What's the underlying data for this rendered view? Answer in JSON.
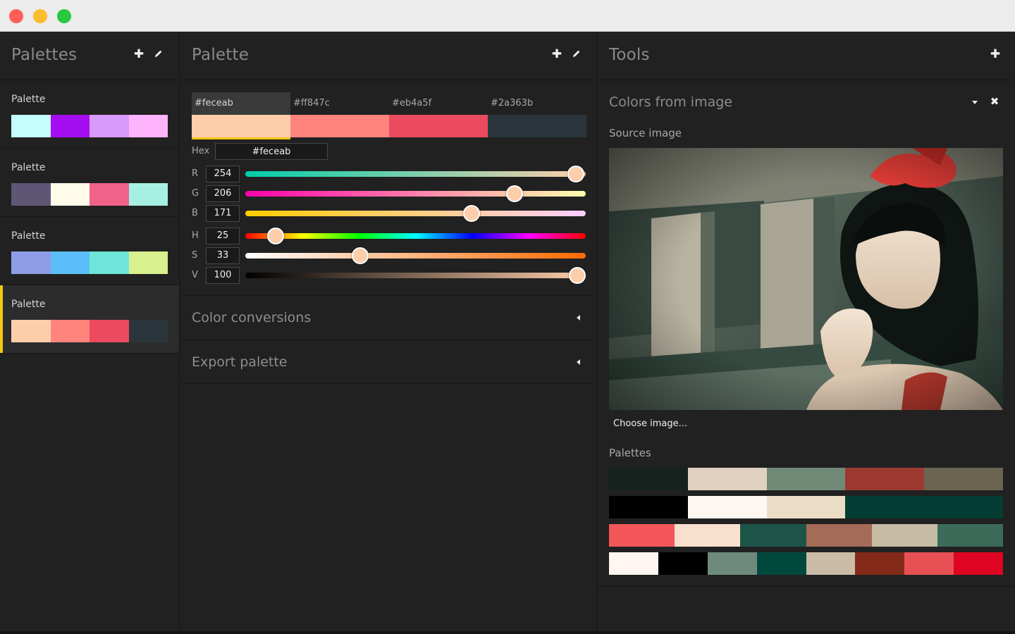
{
  "window": {
    "buttons": [
      "close",
      "minimize",
      "zoom"
    ]
  },
  "palettes_panel": {
    "title": "Palettes",
    "add_icon": "plus-icon",
    "edit_icon": "pencil-icon",
    "items": [
      {
        "name": "Palette",
        "colors": [
          "#c4fdfb",
          "#a50ef2",
          "#d79cf9",
          "#fdb4fd"
        ],
        "active": false
      },
      {
        "name": "Palette",
        "colors": [
          "#5f5676",
          "#fffbea",
          "#f0628a",
          "#a6f0e3"
        ],
        "active": false
      },
      {
        "name": "Palette",
        "colors": [
          "#8d9ee7",
          "#5cbef9",
          "#6de5da",
          "#d9f08f"
        ],
        "active": false
      },
      {
        "name": "Palette",
        "colors": [
          "#feceab",
          "#ff847c",
          "#eb4a5f",
          "#2a363b"
        ],
        "active": true
      }
    ]
  },
  "palette_panel": {
    "title": "Palette",
    "add_icon": "plus-icon",
    "edit_icon": "pencil-icon",
    "tabs": [
      {
        "label": "#feceab",
        "color": "#feceab",
        "selected": true
      },
      {
        "label": "#ff847c",
        "color": "#ff847c",
        "selected": false
      },
      {
        "label": "#eb4a5f",
        "color": "#eb4a5f",
        "selected": false
      },
      {
        "label": "#2a363b",
        "color": "#2a363b",
        "selected": false
      }
    ],
    "hex_label": "Hex",
    "hex_value": "#feceab",
    "sliders": [
      {
        "label": "R",
        "value": "254",
        "fraction": 0.97
      },
      {
        "label": "G",
        "value": "206",
        "fraction": 0.79
      },
      {
        "label": "B",
        "value": "171",
        "fraction": 0.665
      },
      {
        "label": "H",
        "value": "25",
        "fraction": 0.09
      },
      {
        "label": "S",
        "value": "33",
        "fraction": 0.337
      },
      {
        "label": "V",
        "value": "100",
        "fraction": 0.975
      }
    ],
    "sections": [
      "Color conversions",
      "Export palette"
    ]
  },
  "tools_panel": {
    "title": "Tools",
    "add_icon": "plus-icon",
    "tool": {
      "title": "Colors from image",
      "dropdown_icon": "caret-down-icon",
      "close_icon": "close-icon",
      "source_label": "Source image",
      "choose_label": "Choose image...",
      "palettes_label": "Palettes",
      "generated": [
        [
          "#16221d",
          "#e1d1c0",
          "#708a78",
          "#9c3a31",
          "#6b6450"
        ],
        [
          "#010101",
          "#fff7f2",
          "#ebdcc6",
          "#043d33",
          "#043d33"
        ],
        [
          "#f3575a",
          "#f9e0ce",
          "#1c5548",
          "#a46c58",
          "#c6bba5",
          "#3b6a59"
        ],
        [
          "#fff5f1",
          "#000000",
          "#6e8a7c",
          "#01483c",
          "#cbbca8",
          "#842a19",
          "#e85154",
          "#dd0522"
        ]
      ]
    }
  },
  "colors": {
    "accent": "#f2c80f",
    "panel_bg": "#212121"
  }
}
